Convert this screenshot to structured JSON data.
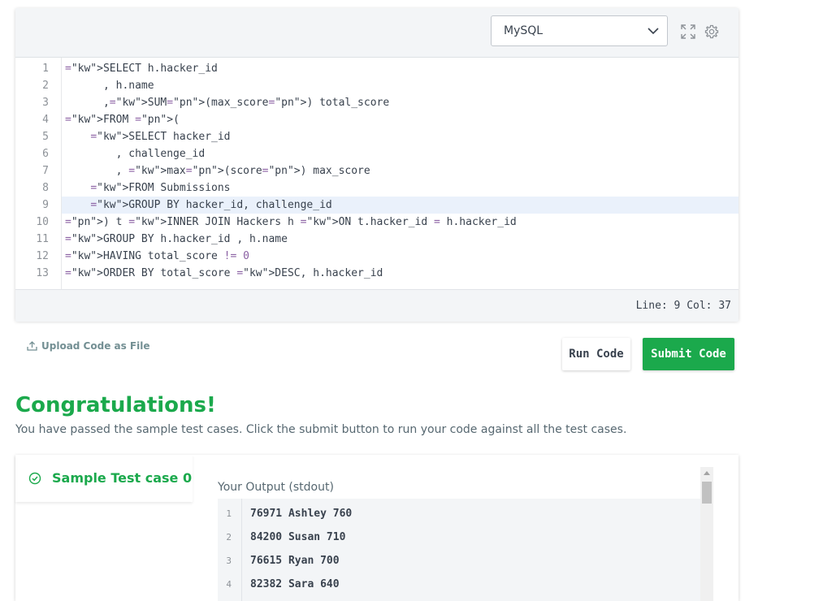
{
  "editor": {
    "language": "MySQL",
    "status": "Line: 9 Col: 37",
    "active_line": 9,
    "lines": [
      "1",
      "2",
      "3",
      "4",
      "5",
      "6",
      "7",
      "8",
      "9",
      "10",
      "11",
      "12",
      "13"
    ],
    "code": [
      "SELECT h.hacker_id",
      "      , h.name",
      "      ,SUM(max_score) total_score",
      "FROM (",
      "    SELECT hacker_id",
      "        , challenge_id",
      "        , max(score) max_score",
      "    FROM Submissions",
      "    GROUP BY hacker_id, challenge_id",
      ") t INNER JOIN Hackers h ON t.hacker_id = h.hacker_id",
      "GROUP BY h.hacker_id , h.name",
      "HAVING total_score != 0",
      "ORDER BY total_score DESC, h.hacker_id"
    ]
  },
  "actions": {
    "upload_label": "Upload Code as File",
    "run_label": "Run Code",
    "submit_label": "Submit Code"
  },
  "result": {
    "title": "Congratulations!",
    "message": "You have passed the sample test cases. Click the submit button to run your code against all the test cases.",
    "test_case_label": "Sample Test case 0",
    "output_label": "Your Output (stdout)",
    "output_lines": [
      {
        "n": "1",
        "text": "76971 Ashley 760"
      },
      {
        "n": "2",
        "text": "84200 Susan 710"
      },
      {
        "n": "3",
        "text": "76615 Ryan 700"
      },
      {
        "n": "4",
        "text": "82382 Sara 640"
      }
    ]
  },
  "colors": {
    "accent_green": "#1ba94c",
    "keyword": "#7d3c98"
  }
}
